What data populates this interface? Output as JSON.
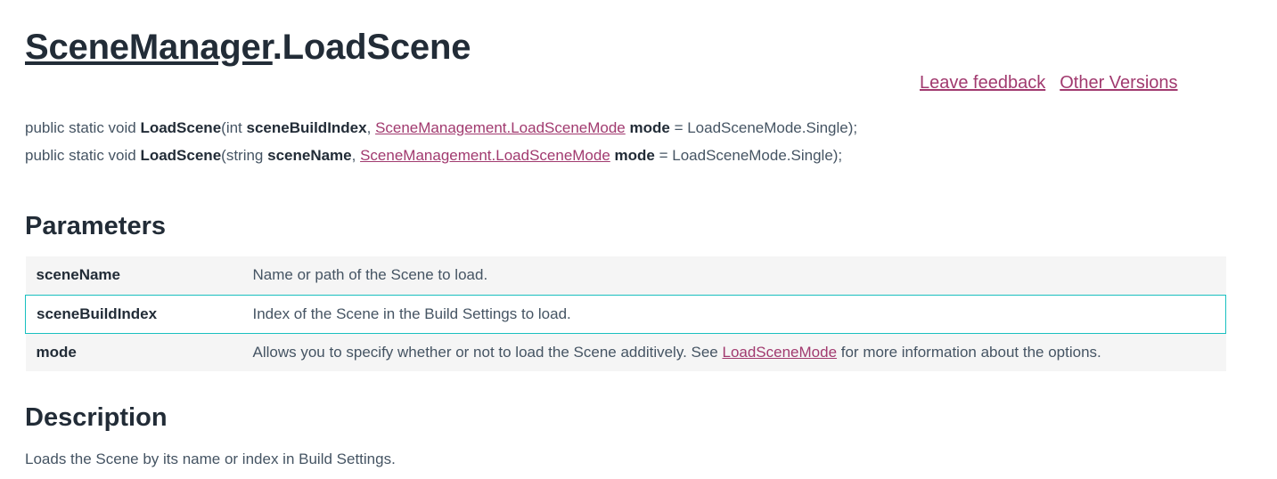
{
  "header": {
    "class_link": "SceneManager",
    "method": ".LoadScene",
    "links": {
      "feedback": "Leave feedback",
      "versions": "Other Versions"
    }
  },
  "signatures": [
    {
      "prefix": "public static void ",
      "name": "LoadScene",
      "param_open": "(int ",
      "param1": "sceneBuildIndex",
      "sep": ", ",
      "type_link": "SceneManagement.LoadSceneMode",
      "space": " ",
      "param2": "mode",
      "suffix": " = LoadSceneMode.Single);"
    },
    {
      "prefix": "public static void ",
      "name": "LoadScene",
      "param_open": "(string ",
      "param1": "sceneName",
      "sep": ", ",
      "type_link": "SceneManagement.LoadSceneMode",
      "space": " ",
      "param2": "mode",
      "suffix": " = LoadSceneMode.Single);"
    }
  ],
  "parameters": {
    "heading": "Parameters",
    "rows": [
      {
        "name": "sceneName",
        "desc": "Name or path of the Scene to load."
      },
      {
        "name": "sceneBuildIndex",
        "desc": "Index of the Scene in the Build Settings to load."
      },
      {
        "name": "mode",
        "desc_before": "Allows you to specify whether or not to load the Scene additively. See ",
        "link": "LoadSceneMode",
        "desc_after": " for more information about the options."
      }
    ]
  },
  "description": {
    "heading": "Description",
    "text": "Loads the Scene by its name or index in Build Settings."
  }
}
